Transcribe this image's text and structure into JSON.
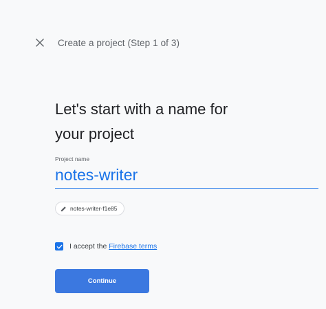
{
  "header": {
    "close_icon": "close-icon",
    "title": "Create a project (Step 1 of 3)"
  },
  "main": {
    "headline_line1": "Let's start with a name for",
    "headline_line2": "your project",
    "project_name": {
      "label": "Project name",
      "value": "notes-writer"
    },
    "project_id_chip": {
      "icon": "pencil-icon",
      "text": "notes-writer-f1e85"
    },
    "terms": {
      "checked": true,
      "prefix": "I accept the ",
      "link": "Firebase terms"
    },
    "continue_label": "Continue"
  },
  "colors": {
    "accent": "#1a73e8",
    "button": "#3b78e0",
    "background": "#f8f9fa"
  }
}
